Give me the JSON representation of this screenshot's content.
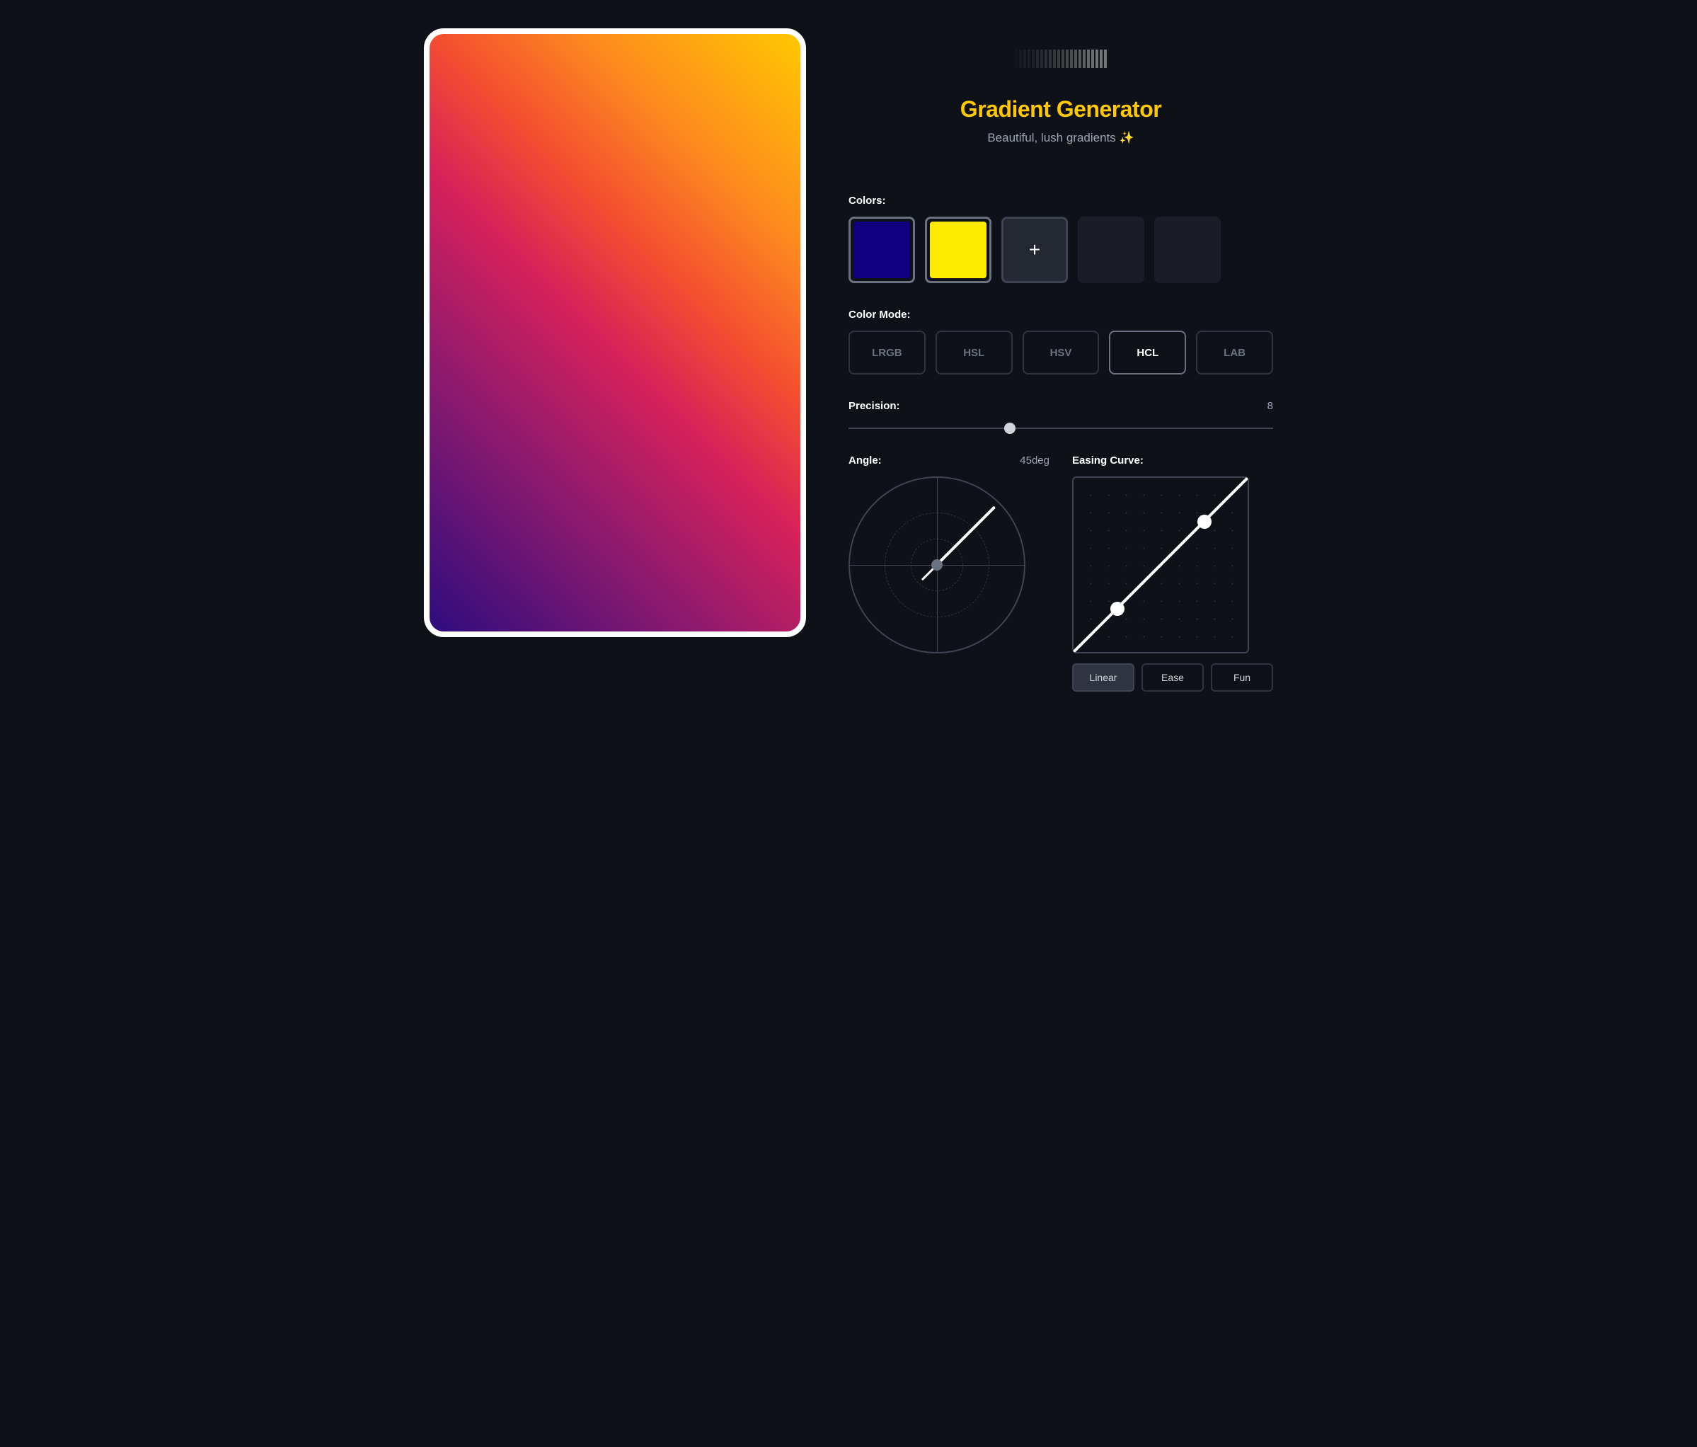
{
  "header": {
    "title": "Gradient Generator",
    "subtitle": "Beautiful, lush gradients ✨"
  },
  "colors": {
    "label": "Colors:",
    "swatches": [
      {
        "color": "#100080",
        "filled": true
      },
      {
        "color": "#ffeb00",
        "filled": true
      }
    ],
    "add_icon": "+"
  },
  "color_mode": {
    "label": "Color Mode:",
    "options": [
      "LRGB",
      "HSL",
      "HSV",
      "HCL",
      "LAB"
    ],
    "selected": "HCL"
  },
  "precision": {
    "label": "Precision:",
    "value": "8",
    "percent": 38
  },
  "angle": {
    "label": "Angle:",
    "value": "45deg",
    "degrees": 45
  },
  "easing": {
    "label": "Easing Curve:",
    "presets": [
      "Linear",
      "Ease",
      "Fun"
    ],
    "selected": "Linear"
  },
  "preview": {
    "gradient_css": "linear-gradient(45deg, #2e0c7e 0%, #8e1a6e 28%, #d7215a 48%, #f44e30 62%, #fd8b1e 78%, #ffc800 100%)"
  },
  "decorative_bar_opacities": [
    0.05,
    0.08,
    0.1,
    0.12,
    0.15,
    0.18,
    0.2,
    0.24,
    0.28,
    0.32,
    0.36,
    0.4,
    0.45,
    0.5,
    0.55,
    0.6,
    0.65,
    0.72,
    0.78,
    0.82,
    0.85,
    0.85
  ]
}
